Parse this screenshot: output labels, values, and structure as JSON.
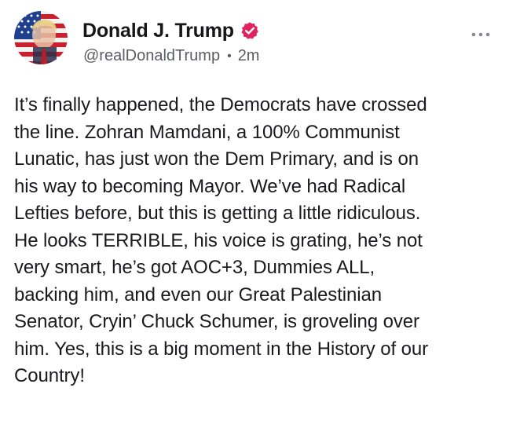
{
  "post": {
    "author": {
      "display_name": "Donald J. Trump",
      "handle": "@realDonaldTrump",
      "verified": true,
      "avatar_icon": "avatar-flag-portrait"
    },
    "separator": "•",
    "time_ago": "2m",
    "more_icon": "more-horizontal-icon",
    "body_lines": [
      "It’s finally happened, the Democrats have crossed",
      "the line. Zohran Mamdani, a 100% Communist",
      "Lunatic, has just won the Dem Primary, and is on",
      "his way to becoming Mayor. We’ve had Radical",
      "Lefties before, but this is getting a little ridiculous.",
      "He looks TERRIBLE, his voice is grating, he’s not",
      "very smart, he’s got AOC+3, Dummies ALL,",
      "backing him, and even our Great Palestinian",
      "Senator, Cryin’ Chuck Schumer, is groveling over",
      "him. Yes, this is a big moment in the History of our",
      "Country!"
    ]
  },
  "colors": {
    "verified_badge": "#e0245e",
    "text_primary": "#1a1a1e",
    "text_secondary": "#5c5c66",
    "background": "#ffffff"
  }
}
